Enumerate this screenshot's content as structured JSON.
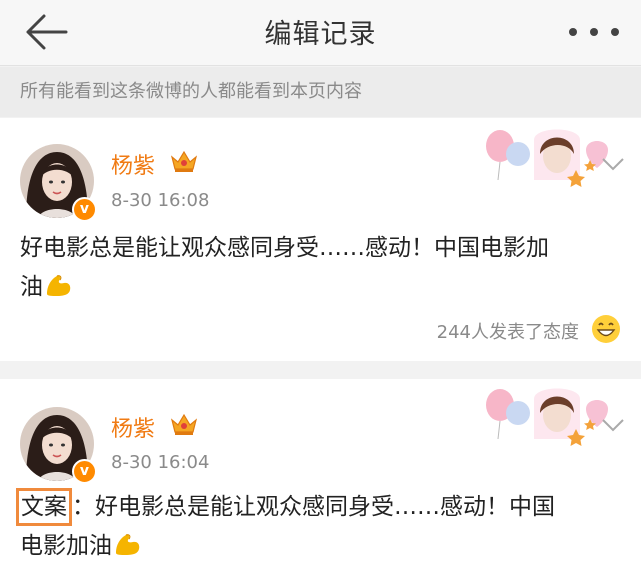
{
  "header": {
    "title": "编辑记录",
    "back_icon": "arrow-left-icon",
    "more_icon": "more-dots-icon"
  },
  "notice": {
    "text": "所有能看到这条微博的人都能看到本页内容"
  },
  "posts": [
    {
      "author": "杨紫",
      "time": "8-30 16:08",
      "text_main": "好电影总是能让观众感同身受……感动！中国电影加",
      "text_tail": "油",
      "reactions_text": "244人发表了态度",
      "reaction_icon": "grin-emoji-icon"
    },
    {
      "author": "杨紫",
      "time": "8-30 16:04",
      "label": "文案",
      "label_sep": "：",
      "text_main": "好电影总是能让观众感同身受……感动！中国",
      "text_tail": "电影加油"
    }
  ],
  "colors": {
    "accent_orange": "#f07b14",
    "highlight_box": "#f08a3c",
    "muted_text": "#8a8a8a"
  }
}
